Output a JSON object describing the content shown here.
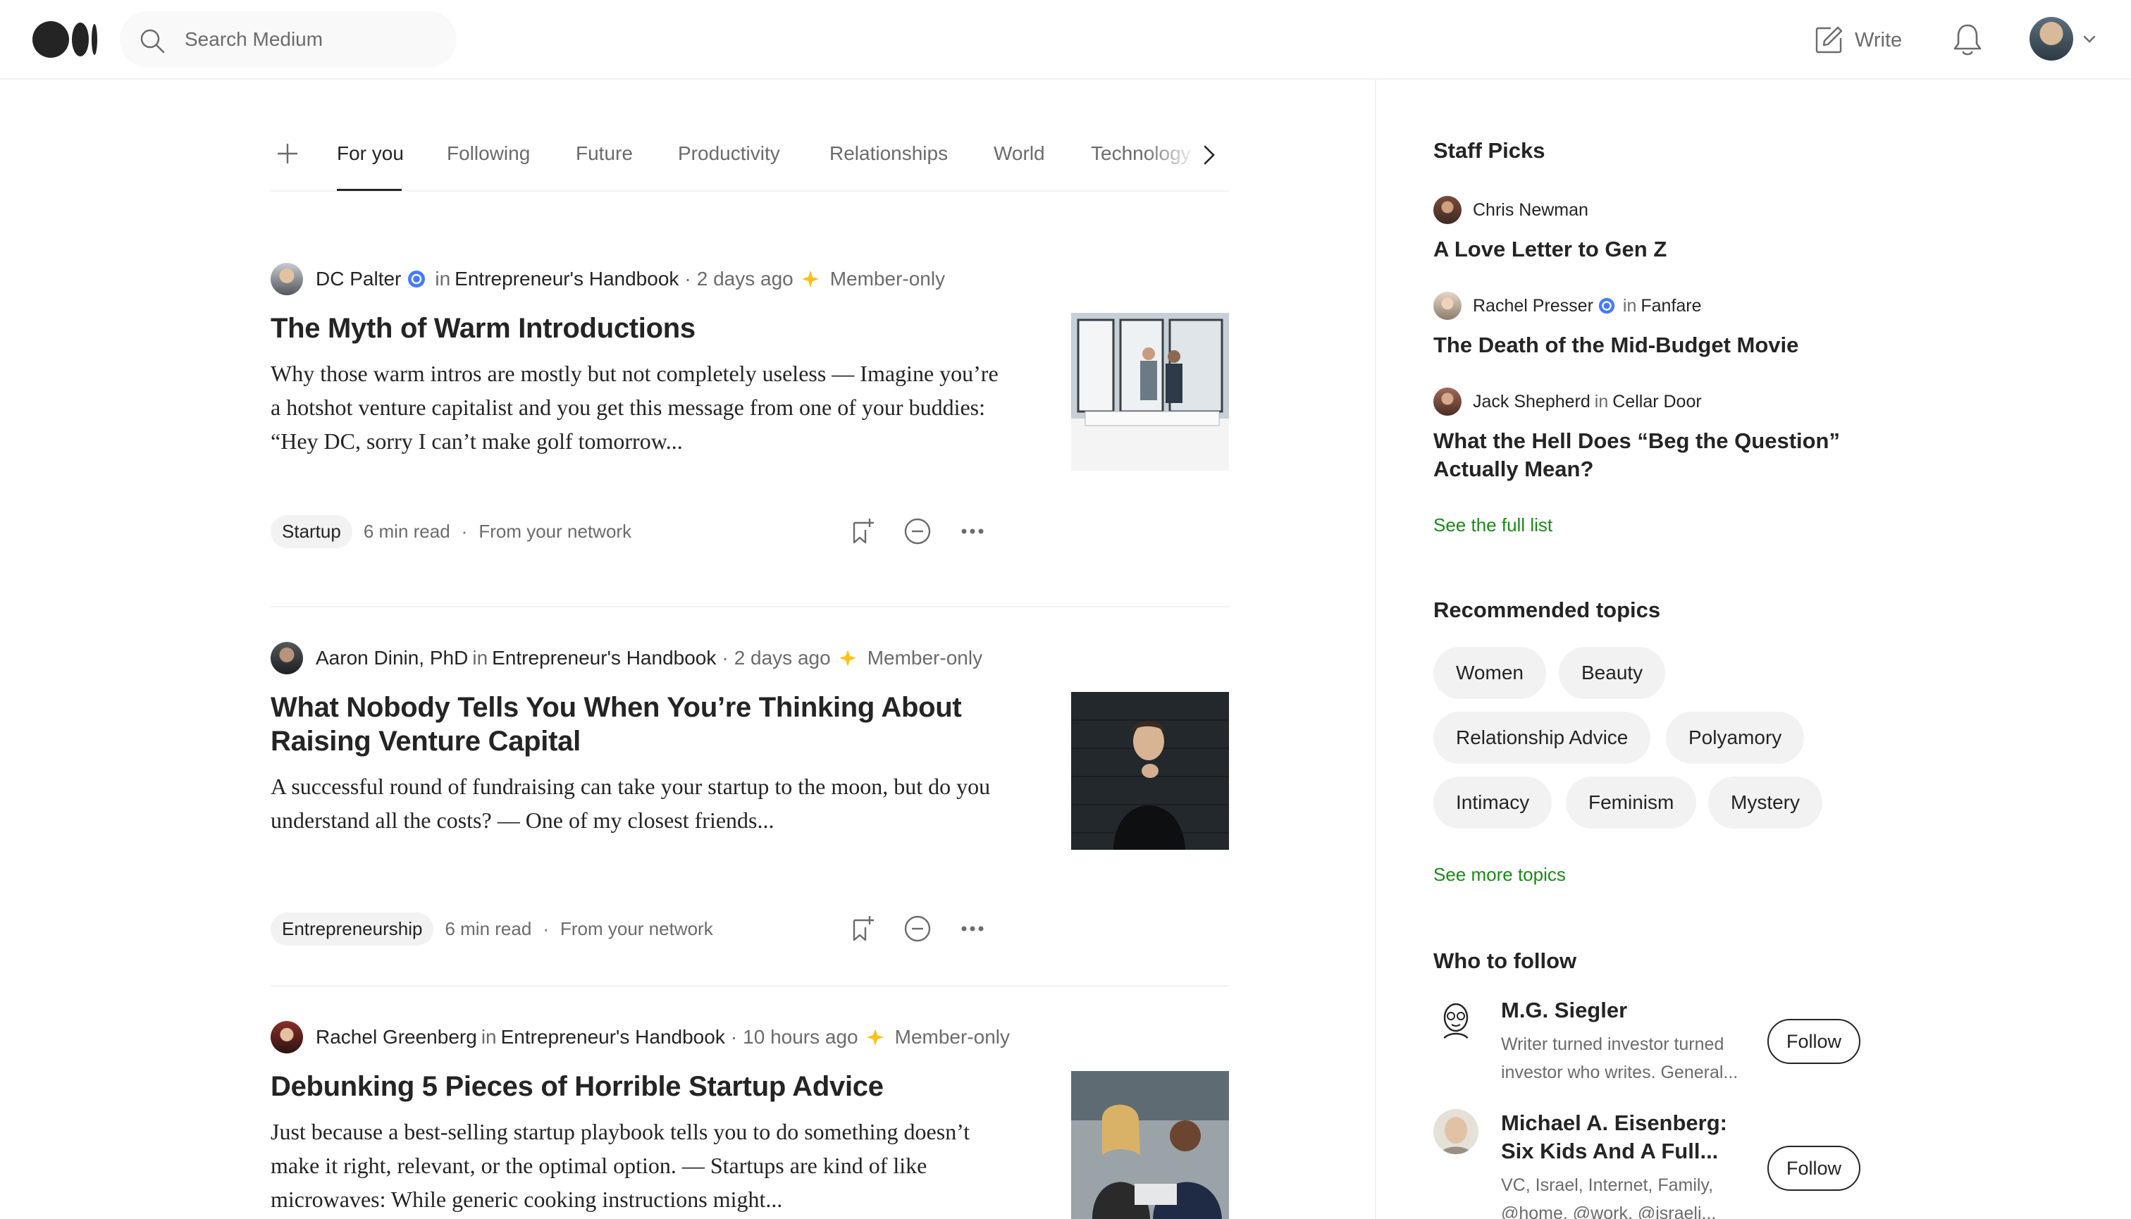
{
  "header": {
    "search_placeholder": "Search Medium",
    "write_label": "Write"
  },
  "tabs": [
    {
      "label": "For you",
      "active": true
    },
    {
      "label": "Following"
    },
    {
      "label": "Future"
    },
    {
      "label": "Productivity"
    },
    {
      "label": "Relationships"
    },
    {
      "label": "World"
    },
    {
      "label": "Technology"
    }
  ],
  "articles": [
    {
      "author": "DC Palter",
      "in": "in",
      "publication": "Entrepreneur's Handbook",
      "ago": "2 days ago",
      "member": "Member-only",
      "title": "The Myth of Warm Introductions",
      "excerpt": "Why those warm intros are mostly but not completely useless — Imagine you’re a hotshot venture capitalist and you get this message from one of your buddies: “Hey DC, sorry I can’t make golf tomorrow...",
      "tag": "Startup",
      "read_time": "6 min read",
      "source": "From your network"
    },
    {
      "author": "Aaron Dinin, PhD",
      "in": "in",
      "publication": "Entrepreneur's Handbook",
      "ago": "2 days ago",
      "member": "Member-only",
      "title": "What Nobody Tells You When You’re Thinking About Raising Venture Capital",
      "excerpt": "A successful round of fundraising can take your startup to the moon, but do you understand all the costs? — One of my closest friends...",
      "tag": "Entrepreneurship",
      "read_time": "6 min read",
      "source": "From your network"
    },
    {
      "author": "Rachel Greenberg",
      "in": "in",
      "publication": "Entrepreneur's Handbook",
      "ago": "10 hours ago",
      "member": "Member-only",
      "title": "Debunking 5 Pieces of Horrible Startup Advice",
      "excerpt": "Just because a best-selling startup playbook tells you to do something doesn’t make it right, relevant, or the optimal option. — Startups are kind of like microwaves: While generic cooking instructions might..."
    }
  ],
  "sidebar": {
    "staff_picks_heading": "Staff Picks",
    "picks": [
      {
        "author": "Chris Newman",
        "title": "A Love Letter to Gen Z"
      },
      {
        "author": "Rachel Presser",
        "in": "in",
        "publication": "Fanfare",
        "title": "The Death of the Mid-Budget Movie"
      },
      {
        "author": "Jack Shepherd",
        "in": "in",
        "publication": "Cellar Door",
        "title": "What the Hell Does “Beg the Question” Actually Mean?"
      }
    ],
    "see_full_list": "See the full list",
    "topics_heading": "Recommended topics",
    "topics": [
      "Women",
      "Beauty",
      "Relationship Advice",
      "Polyamory",
      "Intimacy",
      "Feminism",
      "Mystery"
    ],
    "see_more_topics": "See more topics",
    "who_to_follow_heading": "Who to follow",
    "follow": [
      {
        "name": "M.G. Siegler",
        "bio": "Writer turned investor turned investor who writes. General...",
        "button": "Follow"
      },
      {
        "name": "Michael A. Eisenberg: Six Kids And A Full...",
        "bio": "VC, Israel, Internet, Family, @home, @work, @israeli...",
        "button": "Follow"
      }
    ]
  },
  "colors": {
    "text": "#242424",
    "muted": "#6b6b6b",
    "accent_green": "#1a8917",
    "member_star": "#ffc017",
    "verified_blue": "#437aff"
  }
}
